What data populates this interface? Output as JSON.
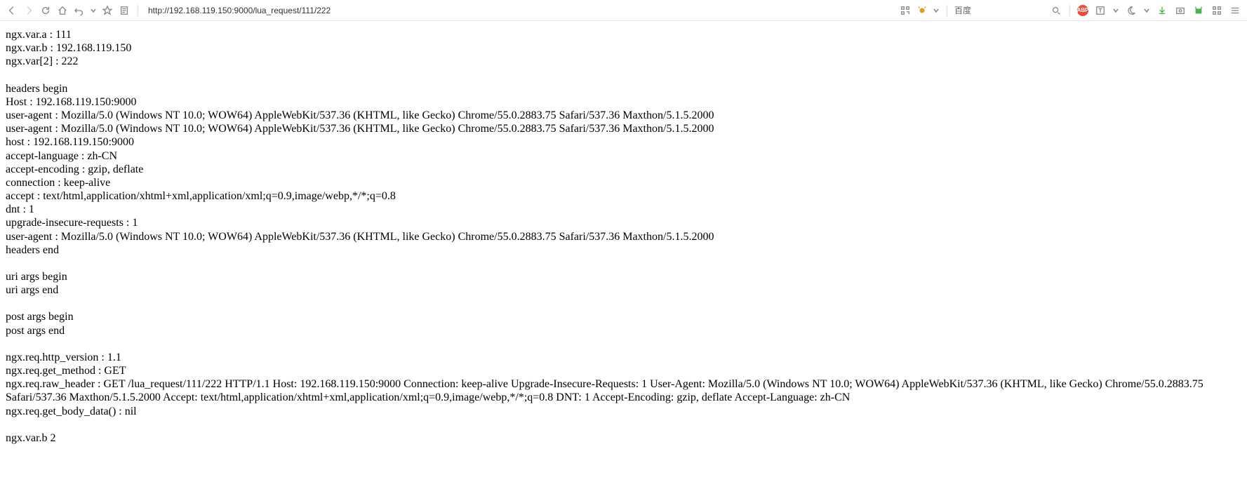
{
  "toolbar": {
    "url": "http://192.168.119.150:9000/lua_request/111/222",
    "search_engine": "百度"
  },
  "body": {
    "lines": [
      "ngx.var.a : 111",
      "ngx.var.b : 192.168.119.150",
      "ngx.var[2] : 222",
      "",
      "headers begin",
      "Host : 192.168.119.150:9000",
      "user-agent : Mozilla/5.0 (Windows NT 10.0; WOW64) AppleWebKit/537.36 (KHTML, like Gecko) Chrome/55.0.2883.75 Safari/537.36 Maxthon/5.1.5.2000",
      "user-agent : Mozilla/5.0 (Windows NT 10.0; WOW64) AppleWebKit/537.36 (KHTML, like Gecko) Chrome/55.0.2883.75 Safari/537.36 Maxthon/5.1.5.2000",
      "host : 192.168.119.150:9000",
      "accept-language : zh-CN",
      "accept-encoding : gzip, deflate",
      "connection : keep-alive",
      "accept : text/html,application/xhtml+xml,application/xml;q=0.9,image/webp,*/*;q=0.8",
      "dnt : 1",
      "upgrade-insecure-requests : 1",
      "user-agent : Mozilla/5.0 (Windows NT 10.0; WOW64) AppleWebKit/537.36 (KHTML, like Gecko) Chrome/55.0.2883.75 Safari/537.36 Maxthon/5.1.5.2000",
      "headers end",
      "",
      "uri args begin",
      "uri args end",
      "",
      "post args begin",
      "post args end",
      "",
      "ngx.req.http_version : 1.1",
      "ngx.req.get_method : GET",
      "ngx.req.raw_header : GET /lua_request/111/222 HTTP/1.1 Host: 192.168.119.150:9000 Connection: keep-alive Upgrade-Insecure-Requests: 1 User-Agent: Mozilla/5.0 (Windows NT 10.0; WOW64) AppleWebKit/537.36 (KHTML, like Gecko) Chrome/55.0.2883.75 Safari/537.36 Maxthon/5.1.5.2000 Accept: text/html,application/xhtml+xml,application/xml;q=0.9,image/webp,*/*;q=0.8 DNT: 1 Accept-Encoding: gzip, deflate Accept-Language: zh-CN",
      "ngx.req.get_body_data() : nil",
      "",
      "ngx.var.b 2"
    ]
  }
}
